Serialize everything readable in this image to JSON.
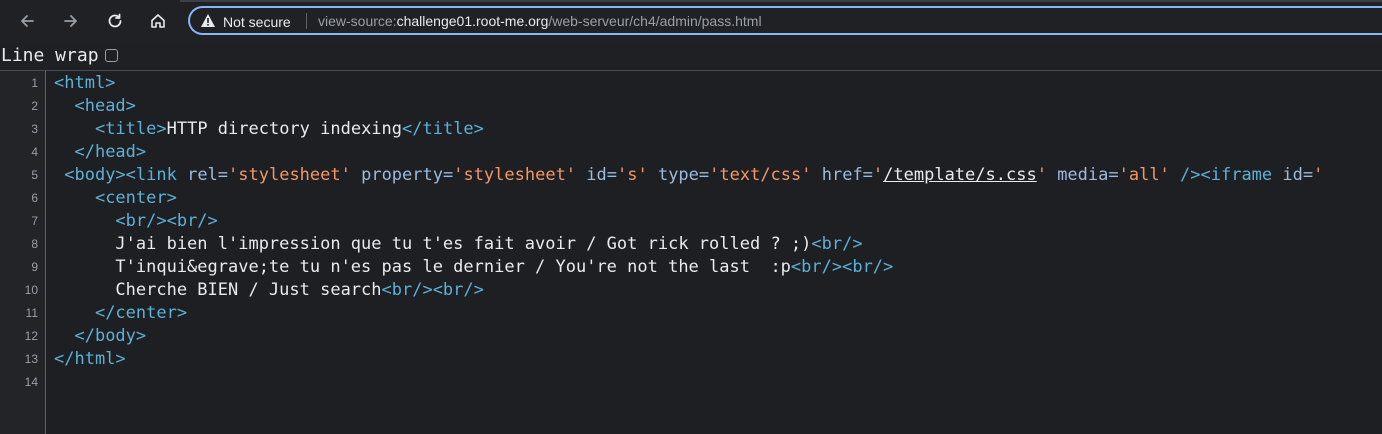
{
  "browser": {
    "security_label": "Not secure",
    "url_prefix": "view-source:",
    "url_host": "challenge01.root-me.org",
    "url_path": "/web-serveur/ch4/admin/pass.html"
  },
  "wrap": {
    "label": "Line wrap",
    "checked": false
  },
  "source": {
    "line_numbers": [
      "1",
      "2",
      "3",
      "4",
      "5",
      "6",
      "7",
      "8",
      "9",
      "10",
      "11",
      "12",
      "13",
      "14"
    ],
    "lines": [
      [
        {
          "t": "tag",
          "v": "<html>"
        }
      ],
      [
        {
          "t": "txt",
          "v": "  "
        },
        {
          "t": "tag",
          "v": "<head>"
        }
      ],
      [
        {
          "t": "txt",
          "v": "    "
        },
        {
          "t": "tag",
          "v": "<title>"
        },
        {
          "t": "txt",
          "v": "HTTP directory indexing"
        },
        {
          "t": "tag",
          "v": "</title>"
        }
      ],
      [
        {
          "t": "txt",
          "v": "  "
        },
        {
          "t": "tag",
          "v": "</head>"
        }
      ],
      [
        {
          "t": "txt",
          "v": " "
        },
        {
          "t": "tag",
          "v": "<body><link "
        },
        {
          "t": "attr",
          "v": "rel="
        },
        {
          "t": "val",
          "v": "'stylesheet'"
        },
        {
          "t": "attr",
          "v": " property="
        },
        {
          "t": "val",
          "v": "'stylesheet'"
        },
        {
          "t": "attr",
          "v": " id="
        },
        {
          "t": "val",
          "v": "'s'"
        },
        {
          "t": "attr",
          "v": " type="
        },
        {
          "t": "val",
          "v": "'text/css'"
        },
        {
          "t": "attr",
          "v": " href="
        },
        {
          "t": "val",
          "v": "'"
        },
        {
          "t": "link",
          "v": "/template/s.css"
        },
        {
          "t": "val",
          "v": "'"
        },
        {
          "t": "attr",
          "v": " media="
        },
        {
          "t": "val",
          "v": "'all'"
        },
        {
          "t": "tag",
          "v": " /><iframe "
        },
        {
          "t": "attr",
          "v": "id="
        },
        {
          "t": "val",
          "v": "'"
        }
      ],
      [
        {
          "t": "txt",
          "v": "    "
        },
        {
          "t": "tag",
          "v": "<center>"
        }
      ],
      [
        {
          "t": "txt",
          "v": "      "
        },
        {
          "t": "tag",
          "v": "<br/><br/>"
        }
      ],
      [
        {
          "t": "txt",
          "v": "      J'ai bien l'impression que tu t'es fait avoir / Got rick rolled ? ;)"
        },
        {
          "t": "tag",
          "v": "<br/>"
        }
      ],
      [
        {
          "t": "txt",
          "v": "      T'inqui&egrave;te tu n'es pas le dernier / You're not the last  :p"
        },
        {
          "t": "tag",
          "v": "<br/><br/>"
        }
      ],
      [
        {
          "t": "txt",
          "v": "      Cherche BIEN / Just search"
        },
        {
          "t": "tag",
          "v": "<br/><br/>"
        }
      ],
      [
        {
          "t": "txt",
          "v": "    "
        },
        {
          "t": "tag",
          "v": "</center>"
        }
      ],
      [
        {
          "t": "txt",
          "v": "  "
        },
        {
          "t": "tag",
          "v": "</body>"
        }
      ],
      [
        {
          "t": "tag",
          "v": "</html>"
        }
      ],
      []
    ]
  }
}
